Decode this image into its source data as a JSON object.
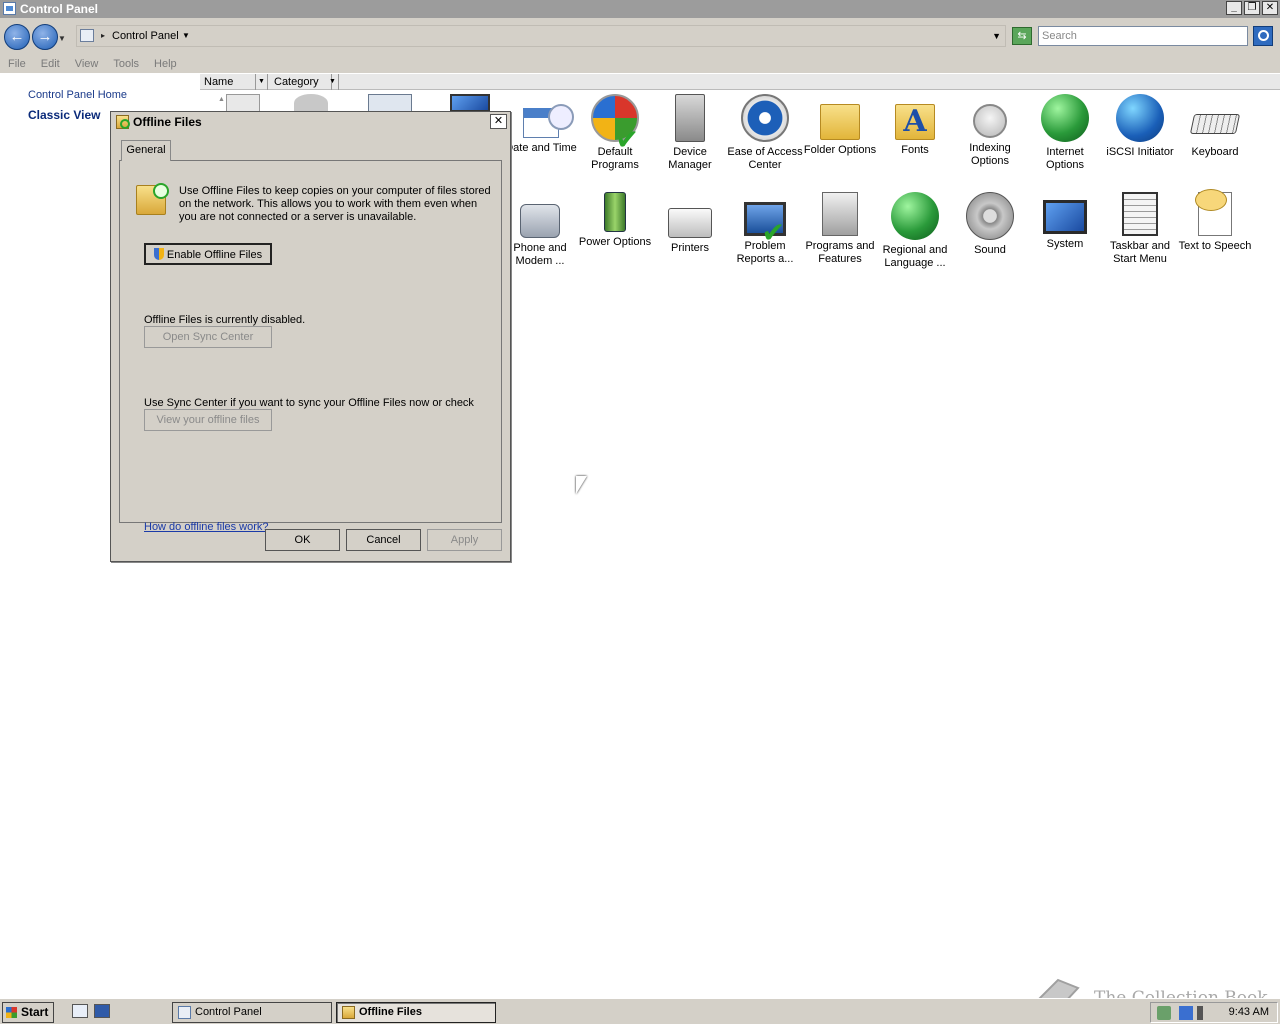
{
  "window": {
    "title": "Control Panel"
  },
  "address": {
    "breadcrumb": "Control Panel",
    "search_placeholder": "Search"
  },
  "menu": [
    "File",
    "Edit",
    "View",
    "Tools",
    "Help"
  ],
  "left_pane": {
    "home_link": "Control Panel Home",
    "classic_view": "Classic View"
  },
  "columns": {
    "name": "Name",
    "category": "Category"
  },
  "items_row1": [
    {
      "label": "Date and Time",
      "icon": "calendar-clock-icon"
    },
    {
      "label": "Default Programs",
      "icon": "default-programs-icon"
    },
    {
      "label": "Device Manager",
      "icon": "device-manager-icon"
    },
    {
      "label": "Ease of Access Center",
      "icon": "ease-of-access-icon"
    },
    {
      "label": "Folder Options",
      "icon": "folder-options-icon"
    },
    {
      "label": "Fonts",
      "icon": "fonts-folder-icon"
    },
    {
      "label": "Indexing Options",
      "icon": "indexing-options-icon"
    },
    {
      "label": "Internet Options",
      "icon": "internet-options-icon"
    },
    {
      "label": "iSCSI Initiator",
      "icon": "iscsi-initiator-icon"
    },
    {
      "label": "Keyboard",
      "icon": "keyboard-icon"
    }
  ],
  "items_row2": [
    {
      "label": "Phone and Modem ...",
      "icon": "phone-modem-icon"
    },
    {
      "label": "Power Options",
      "icon": "power-options-icon"
    },
    {
      "label": "Printers",
      "icon": "printer-icon"
    },
    {
      "label": "Problem Reports a...",
      "icon": "problem-reports-icon"
    },
    {
      "label": "Programs and Features",
      "icon": "programs-features-icon"
    },
    {
      "label": "Regional and Language ...",
      "icon": "regional-language-icon"
    },
    {
      "label": "Sound",
      "icon": "sound-icon"
    },
    {
      "label": "System",
      "icon": "system-icon"
    },
    {
      "label": "Taskbar and Start Menu",
      "icon": "taskbar-start-menu-icon"
    },
    {
      "label": "Text to Speech",
      "icon": "text-to-speech-icon"
    }
  ],
  "dialog": {
    "title": "Offline Files",
    "tab": "General",
    "info": "Use Offline Files to keep copies on your computer of files stored on the network.  This allows you to work with them even when you are not connected or a server is unavailable.",
    "enable_button": "Enable Offline Files",
    "status": "Offline Files is currently disabled.",
    "sync_button": "Open Sync Center",
    "sync_info": "Use Sync Center if you want to sync your Offline Files now or check for sync conflicts.",
    "view_button": "View your offline files",
    "help_link": "How do offline files work?",
    "ok": "OK",
    "cancel": "Cancel",
    "apply": "Apply"
  },
  "taskbar": {
    "start": "Start",
    "tasks": [
      "Control Panel",
      "Offline Files"
    ],
    "clock": "9:43 AM"
  },
  "watermark": "The Collection Book"
}
